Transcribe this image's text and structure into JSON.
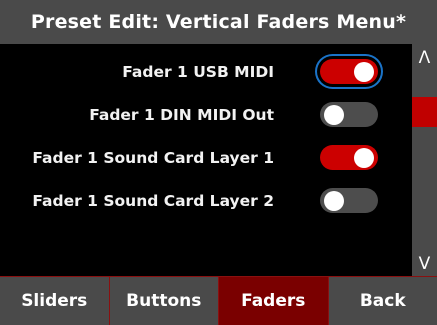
{
  "title": "Preset Edit: Vertical Faders Menu*",
  "settings": [
    {
      "label": "Fader 1 USB MIDI",
      "enabled": true,
      "focused": true
    },
    {
      "label": "Fader 1 DIN MIDI Out",
      "enabled": false,
      "focused": false
    },
    {
      "label": "Fader 1 Sound Card Layer 1",
      "enabled": true,
      "focused": false
    },
    {
      "label": "Fader 1 Sound Card Layer 2",
      "enabled": false,
      "focused": false
    }
  ],
  "scrollbar": {
    "up_icon": "chevron-up-icon",
    "down_icon": "chevron-down-icon",
    "up_glyph": "Λ",
    "down_glyph": "V"
  },
  "tabs": [
    {
      "label": "Sliders",
      "active": false
    },
    {
      "label": "Buttons",
      "active": false
    },
    {
      "label": "Faders",
      "active": true
    },
    {
      "label": "Back",
      "active": false
    }
  ],
  "colors": {
    "accent": "#cc0000",
    "tab_active": "#7a0000",
    "panel": "#4a4a4a",
    "focus_ring": "#1a73c8",
    "background": "#000000"
  }
}
